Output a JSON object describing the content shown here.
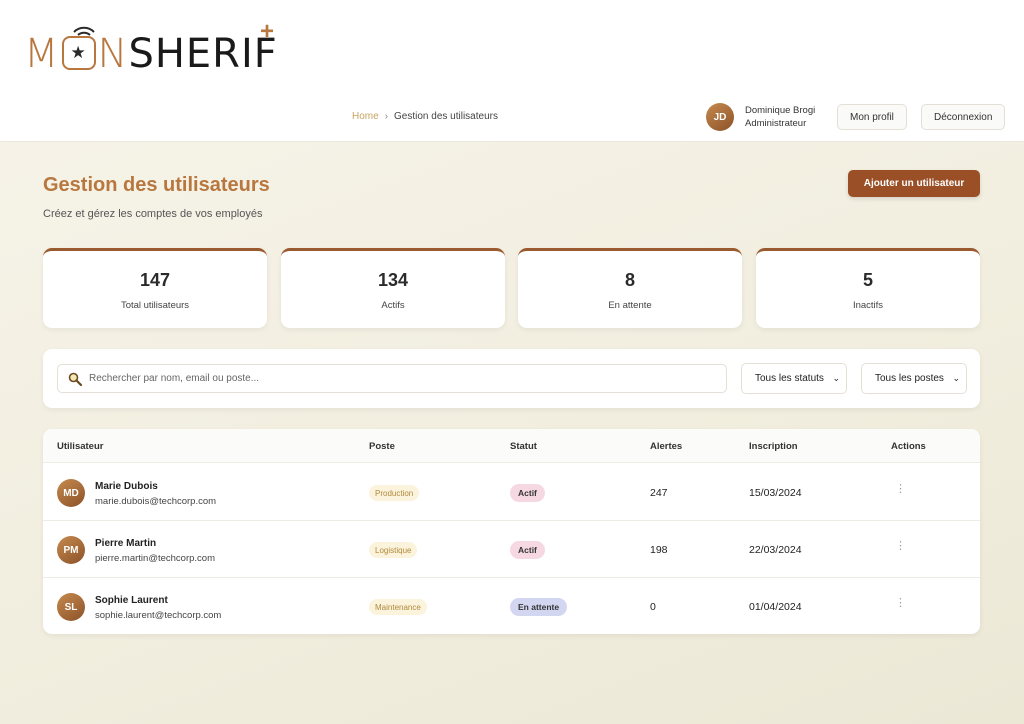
{
  "brand": {
    "logo_prefix": "M",
    "logo_mid": "N",
    "logo_main": "SHERIF",
    "logo_plus": "+",
    "accent": "#b8773f"
  },
  "breadcrumb": {
    "home": "Home",
    "separator": "›",
    "current": "Gestion des utilisateurs"
  },
  "user": {
    "initials": "JD",
    "name": "Dominique Brogi",
    "role": "Administrateur"
  },
  "header_actions": {
    "profile": "Mon profil",
    "logout": "Déconnexion"
  },
  "page": {
    "title": "Gestion des utilisateurs",
    "subtitle": "Créez et gérez les comptes de vos employés",
    "add_button": "Ajouter un utilisateur"
  },
  "stats": [
    {
      "value": "147",
      "label": "Total utilisateurs"
    },
    {
      "value": "134",
      "label": "Actifs"
    },
    {
      "value": "8",
      "label": "En attente"
    },
    {
      "value": "5",
      "label": "Inactifs"
    }
  ],
  "filters": {
    "search_placeholder": "Rechercher par nom, email ou poste...",
    "status_selected": "Tous les statuts",
    "poste_selected": "Tous les postes"
  },
  "table": {
    "headers": [
      "Utilisateur",
      "Poste",
      "Statut",
      "Alertes",
      "Inscription",
      "Actions"
    ],
    "rows": [
      {
        "initials": "MD",
        "name": "Marie Dubois",
        "email": "marie.dubois@techcorp.com",
        "poste": "Production",
        "statut": "Actif",
        "alertes": "247",
        "inscription": "15/03/2024",
        "actions": "⋮"
      },
      {
        "initials": "PM",
        "name": "Pierre Martin",
        "email": "pierre.martin@techcorp.com",
        "poste": "Logistique",
        "statut": "Actif",
        "alertes": "198",
        "inscription": "22/03/2024",
        "actions": "⋮"
      },
      {
        "initials": "SL",
        "name": "Sophie Laurent",
        "email": "sophie.laurent@techcorp.com",
        "poste": "Maintenance",
        "statut": "En attente",
        "alertes": "0",
        "inscription": "01/04/2024",
        "actions": "⋮"
      }
    ]
  },
  "colors": {
    "primary_button": "#9a4f27",
    "title": "#b8773f",
    "status_actif_bg": "#f6d8e3",
    "status_attente_bg": "#d3d6f0",
    "poste_bg": "#fbf3dc"
  }
}
